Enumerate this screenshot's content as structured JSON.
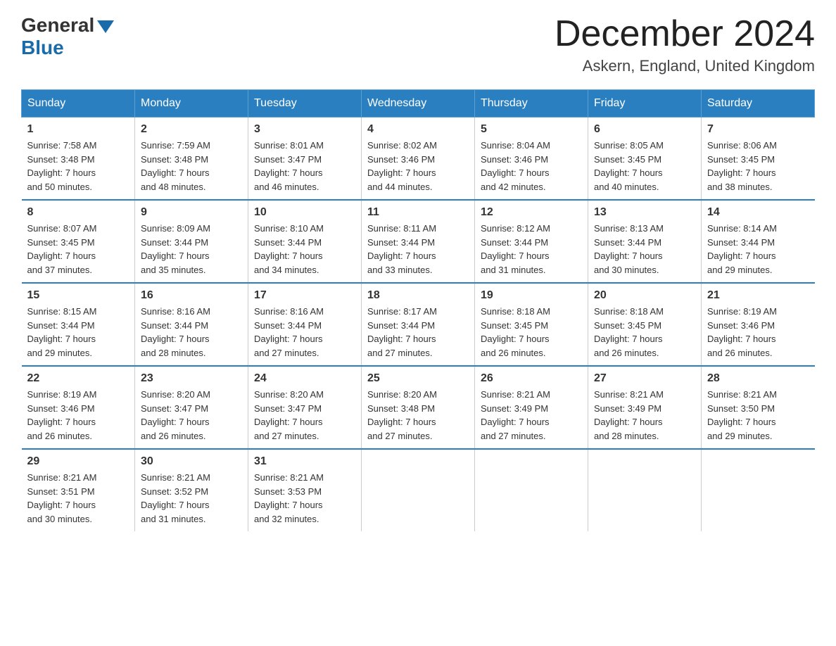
{
  "header": {
    "logo_general": "General",
    "logo_blue": "Blue",
    "title": "December 2024",
    "subtitle": "Askern, England, United Kingdom"
  },
  "weekdays": [
    "Sunday",
    "Monday",
    "Tuesday",
    "Wednesday",
    "Thursday",
    "Friday",
    "Saturday"
  ],
  "weeks": [
    [
      {
        "day": "1",
        "sunrise": "7:58 AM",
        "sunset": "3:48 PM",
        "daylight": "7 hours and 50 minutes."
      },
      {
        "day": "2",
        "sunrise": "7:59 AM",
        "sunset": "3:48 PM",
        "daylight": "7 hours and 48 minutes."
      },
      {
        "day": "3",
        "sunrise": "8:01 AM",
        "sunset": "3:47 PM",
        "daylight": "7 hours and 46 minutes."
      },
      {
        "day": "4",
        "sunrise": "8:02 AM",
        "sunset": "3:46 PM",
        "daylight": "7 hours and 44 minutes."
      },
      {
        "day": "5",
        "sunrise": "8:04 AM",
        "sunset": "3:46 PM",
        "daylight": "7 hours and 42 minutes."
      },
      {
        "day": "6",
        "sunrise": "8:05 AM",
        "sunset": "3:45 PM",
        "daylight": "7 hours and 40 minutes."
      },
      {
        "day": "7",
        "sunrise": "8:06 AM",
        "sunset": "3:45 PM",
        "daylight": "7 hours and 38 minutes."
      }
    ],
    [
      {
        "day": "8",
        "sunrise": "8:07 AM",
        "sunset": "3:45 PM",
        "daylight": "7 hours and 37 minutes."
      },
      {
        "day": "9",
        "sunrise": "8:09 AM",
        "sunset": "3:44 PM",
        "daylight": "7 hours and 35 minutes."
      },
      {
        "day": "10",
        "sunrise": "8:10 AM",
        "sunset": "3:44 PM",
        "daylight": "7 hours and 34 minutes."
      },
      {
        "day": "11",
        "sunrise": "8:11 AM",
        "sunset": "3:44 PM",
        "daylight": "7 hours and 33 minutes."
      },
      {
        "day": "12",
        "sunrise": "8:12 AM",
        "sunset": "3:44 PM",
        "daylight": "7 hours and 31 minutes."
      },
      {
        "day": "13",
        "sunrise": "8:13 AM",
        "sunset": "3:44 PM",
        "daylight": "7 hours and 30 minutes."
      },
      {
        "day": "14",
        "sunrise": "8:14 AM",
        "sunset": "3:44 PM",
        "daylight": "7 hours and 29 minutes."
      }
    ],
    [
      {
        "day": "15",
        "sunrise": "8:15 AM",
        "sunset": "3:44 PM",
        "daylight": "7 hours and 29 minutes."
      },
      {
        "day": "16",
        "sunrise": "8:16 AM",
        "sunset": "3:44 PM",
        "daylight": "7 hours and 28 minutes."
      },
      {
        "day": "17",
        "sunrise": "8:16 AM",
        "sunset": "3:44 PM",
        "daylight": "7 hours and 27 minutes."
      },
      {
        "day": "18",
        "sunrise": "8:17 AM",
        "sunset": "3:44 PM",
        "daylight": "7 hours and 27 minutes."
      },
      {
        "day": "19",
        "sunrise": "8:18 AM",
        "sunset": "3:45 PM",
        "daylight": "7 hours and 26 minutes."
      },
      {
        "day": "20",
        "sunrise": "8:18 AM",
        "sunset": "3:45 PM",
        "daylight": "7 hours and 26 minutes."
      },
      {
        "day": "21",
        "sunrise": "8:19 AM",
        "sunset": "3:46 PM",
        "daylight": "7 hours and 26 minutes."
      }
    ],
    [
      {
        "day": "22",
        "sunrise": "8:19 AM",
        "sunset": "3:46 PM",
        "daylight": "7 hours and 26 minutes."
      },
      {
        "day": "23",
        "sunrise": "8:20 AM",
        "sunset": "3:47 PM",
        "daylight": "7 hours and 26 minutes."
      },
      {
        "day": "24",
        "sunrise": "8:20 AM",
        "sunset": "3:47 PM",
        "daylight": "7 hours and 27 minutes."
      },
      {
        "day": "25",
        "sunrise": "8:20 AM",
        "sunset": "3:48 PM",
        "daylight": "7 hours and 27 minutes."
      },
      {
        "day": "26",
        "sunrise": "8:21 AM",
        "sunset": "3:49 PM",
        "daylight": "7 hours and 27 minutes."
      },
      {
        "day": "27",
        "sunrise": "8:21 AM",
        "sunset": "3:49 PM",
        "daylight": "7 hours and 28 minutes."
      },
      {
        "day": "28",
        "sunrise": "8:21 AM",
        "sunset": "3:50 PM",
        "daylight": "7 hours and 29 minutes."
      }
    ],
    [
      {
        "day": "29",
        "sunrise": "8:21 AM",
        "sunset": "3:51 PM",
        "daylight": "7 hours and 30 minutes."
      },
      {
        "day": "30",
        "sunrise": "8:21 AM",
        "sunset": "3:52 PM",
        "daylight": "7 hours and 31 minutes."
      },
      {
        "day": "31",
        "sunrise": "8:21 AM",
        "sunset": "3:53 PM",
        "daylight": "7 hours and 32 minutes."
      },
      null,
      null,
      null,
      null
    ]
  ],
  "labels": {
    "sunrise": "Sunrise:",
    "sunset": "Sunset:",
    "daylight": "Daylight:"
  }
}
